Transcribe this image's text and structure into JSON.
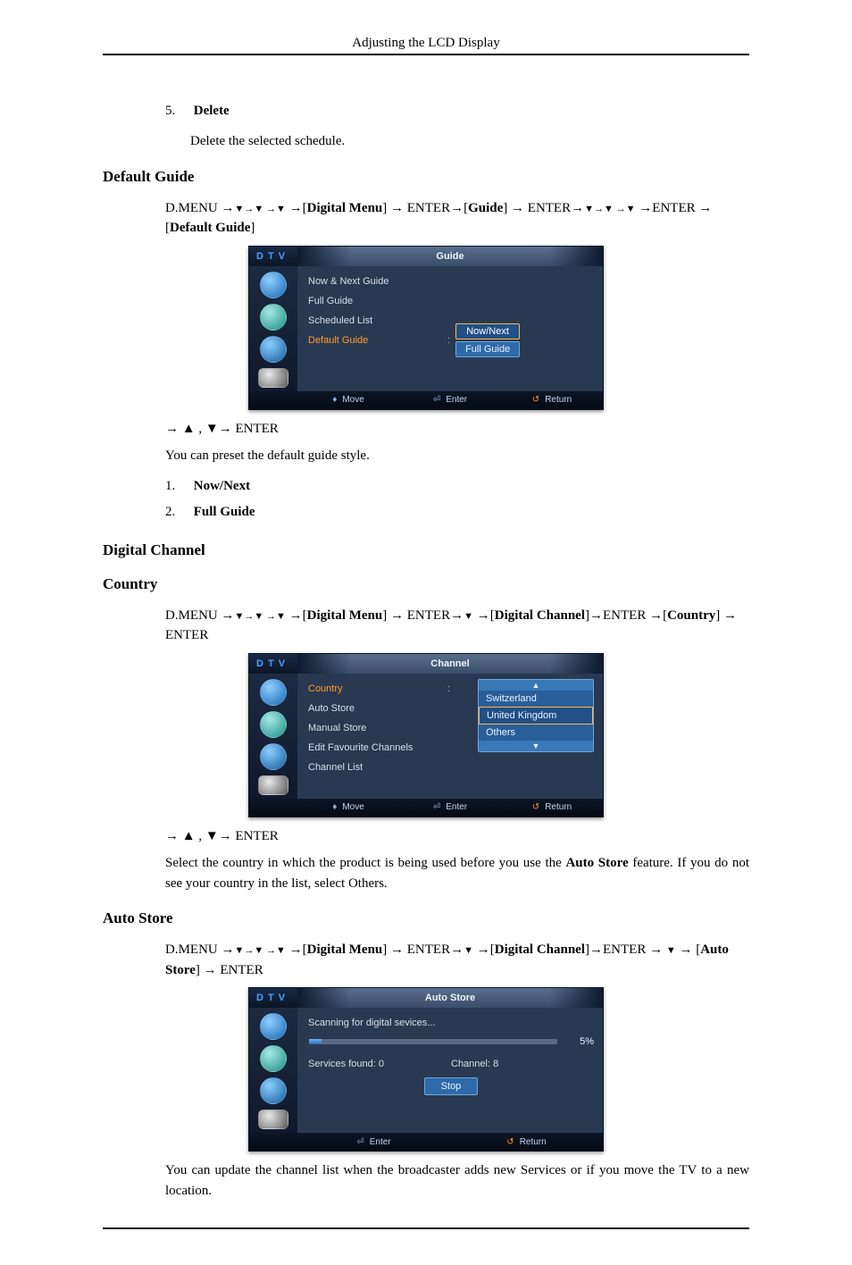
{
  "header": {
    "title": "Adjusting the LCD Display"
  },
  "list_delete": {
    "num": "5.",
    "title": "Delete",
    "desc": "Delete the selected schedule."
  },
  "default_guide": {
    "heading": "Default Guide",
    "path_a": "D.MENU →",
    "path_b": " →[",
    "dm": "Digital Menu",
    "path_c": "] → ENTER→[",
    "guide_lbl": "Guide",
    "path_d": "] → ENTER→",
    "path_e": " →ENTER → [",
    "dg": "Default Guide",
    "path_f": "]",
    "osd": {
      "dtv": "D T V",
      "title": "Guide",
      "rows": {
        "r1": "Now & Next Guide",
        "r2": "Full Guide",
        "r3": "Scheduled List",
        "r4": "Default Guide",
        "opt1": "Now/Next",
        "opt2": "Full Guide"
      },
      "footer": {
        "move": "Move",
        "enter": "Enter",
        "return": "Return"
      }
    },
    "after": "→ ▲ , ▼→ ENTER",
    "desc": "You can preset the default guide style.",
    "items": [
      {
        "num": "1.",
        "label": "Now/Next"
      },
      {
        "num": "2.",
        "label": "Full Guide"
      }
    ]
  },
  "digital_channel": {
    "heading": "Digital Channel"
  },
  "country": {
    "heading": "Country",
    "path_a": "D.MENU →",
    "path_b": " →[",
    "dm": "Digital Menu",
    "path_c": "] → ENTER→",
    "path_d": " →[",
    "dc": "Digital Channel",
    "path_e": "]→ENTER →[",
    "co": "Country",
    "path_f": "] → ENTER",
    "osd": {
      "dtv": "D T V",
      "title": "Channel",
      "rows": {
        "r1": "Country",
        "r2": "Auto Store",
        "r3": "Manual Store",
        "r4": "Edit Favourite Channels",
        "r5": "Channel List",
        "hdr": "▲",
        "opt1": "Switzerland",
        "opt2": "United Kingdom",
        "opt3": "Others",
        "ftr": "▼"
      },
      "footer": {
        "move": "Move",
        "enter": "Enter",
        "return": "Return"
      }
    },
    "after": "→ ▲ , ▼→ ENTER",
    "desc_a": "Select the country in which the product is being used before you use the ",
    "auto_store_b": "Auto Store",
    "desc_b": " feature. If you do not see your country in the list, select Others."
  },
  "auto_store": {
    "heading": "Auto Store",
    "path_a": "D.MENU →",
    "path_b": " →[",
    "dm": "Digital Menu",
    "path_c": "] → ENTER→",
    "path_d": " →[",
    "dc": "Digital Channel",
    "path_e": "]→ENTER → ",
    "path_f": " → [",
    "as": "Auto Store",
    "path_g": "] → ENTER",
    "osd": {
      "dtv": "D T V",
      "title": "Auto Store",
      "scanning": "Scanning for digital sevices...",
      "pct": "5%",
      "found": "Services found: 0",
      "channel": "Channel: 8",
      "stop": "Stop",
      "footer": {
        "enter": "Enter",
        "return": "Return"
      }
    },
    "desc": "You can update the channel list when the broadcaster adds new Services or if you move the TV to a new location."
  }
}
